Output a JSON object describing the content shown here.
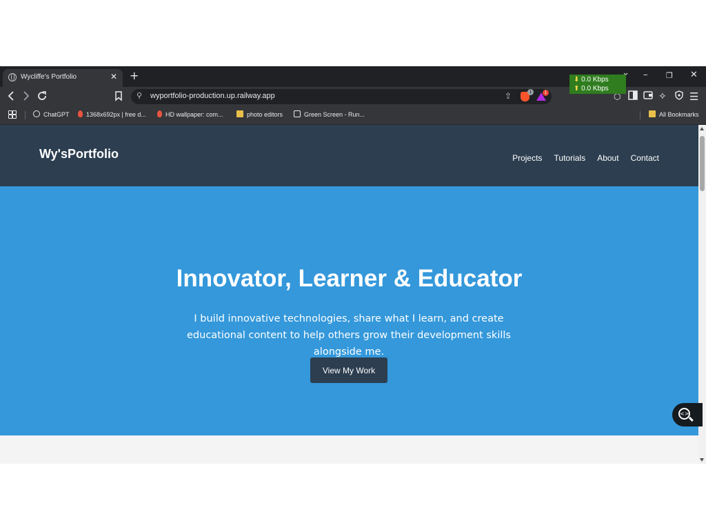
{
  "browser": {
    "tab_title": "Wycliffe's Portfolio",
    "tab_close": "✕",
    "new_tab": "+",
    "window_controls": {
      "dropdown": "⌄",
      "minimize": "–",
      "restore": "❐",
      "close": "✕"
    },
    "url": "wyportfolio-production.up.railway.app",
    "brave_badge": "1",
    "rewards_badge": "1",
    "speed": {
      "down": "0.0 Kbps",
      "up": "0.0 Kbps"
    },
    "bookmarks": [
      {
        "label": "ChatGPT",
        "icon": "chatgpt-icon"
      },
      {
        "label": "1368x692px | free d...",
        "icon": "flame-icon"
      },
      {
        "label": "HD wallpaper: com...",
        "icon": "flame-icon"
      },
      {
        "label": "photo editors",
        "icon": "folder-icon"
      },
      {
        "label": "Green Screen - Run...",
        "icon": "runway-icon"
      }
    ],
    "all_bookmarks": "All Bookmarks"
  },
  "site": {
    "logo": "Wy'sPortfolio",
    "nav": [
      "Projects",
      "Tutorials",
      "About",
      "Contact"
    ],
    "hero": {
      "title": "Innovator, Learner & Educator",
      "subtitle": "I build innovative technologies, share what I learn, and create educational content to help others grow their development skills alongside me.",
      "cta": "View My Work"
    }
  },
  "colors": {
    "nav_bg": "#2c3e50",
    "hero_bg": "#3498db",
    "cta_bg": "#2c3e50",
    "section_bg": "#f4f4f4"
  }
}
